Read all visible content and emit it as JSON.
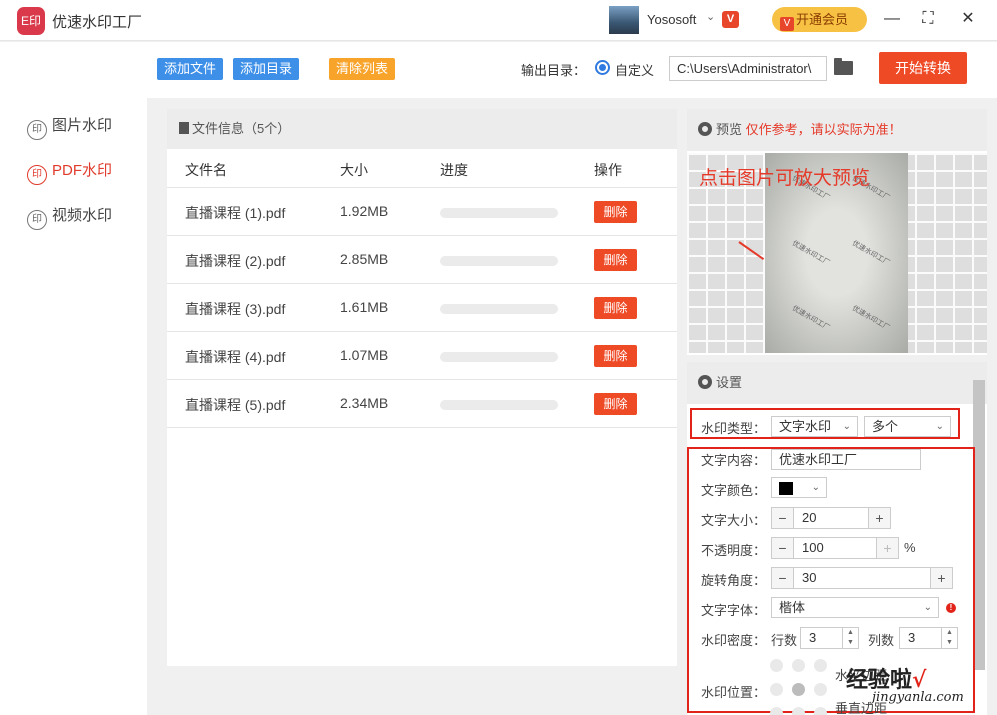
{
  "app": {
    "title": "优速水印工厂",
    "logo_text": "E印"
  },
  "user": {
    "name": "Yososoft",
    "vip_badge": "V",
    "vip_button": "开通会员"
  },
  "window": {
    "minimize": "—",
    "maximize": "⛶",
    "close": "✕"
  },
  "sidebar": {
    "items": [
      {
        "label": "图片水印",
        "icon": "印"
      },
      {
        "label": "PDF水印",
        "icon": "印"
      },
      {
        "label": "视频水印",
        "icon": "印"
      }
    ]
  },
  "toolbar": {
    "add_file": "添加文件",
    "add_folder": "添加目录",
    "clear_list": "清除列表",
    "output_label": "输出目录：",
    "custom_label": "自定义",
    "output_path": "C:\\Users\\Administrator\\",
    "start": "开始转换"
  },
  "files": {
    "header": "文件信息（5个）",
    "columns": {
      "name": "文件名",
      "size": "大小",
      "progress": "进度",
      "action": "操作"
    },
    "rows": [
      {
        "name": "直播课程 (1).pdf",
        "size": "1.92MB",
        "progress": 0,
        "action": "删除"
      },
      {
        "name": "直播课程 (2).pdf",
        "size": "2.85MB",
        "progress": 0,
        "action": "删除"
      },
      {
        "name": "直播课程 (3).pdf",
        "size": "1.61MB",
        "progress": 0,
        "action": "删除"
      },
      {
        "name": "直播课程 (4).pdf",
        "size": "1.07MB",
        "progress": 0,
        "action": "删除"
      },
      {
        "name": "直播课程 (5).pdf",
        "size": "2.34MB",
        "progress": 0,
        "action": "删除"
      }
    ]
  },
  "preview": {
    "title": "预览",
    "note": "仅作参考，请以实际为准！",
    "hint": "点击图片可放大预览",
    "doc_watermark": "优速水印工厂"
  },
  "settings": {
    "title": "设置",
    "watermark_type_label": "水印类型：",
    "watermark_type": "文字水印",
    "watermark_mode": "多个",
    "text_content_label": "文字内容：",
    "text_content": "优速水印工厂",
    "text_color_label": "文字颜色：",
    "text_color": "#000000",
    "text_size_label": "文字大小：",
    "text_size": "20",
    "opacity_label": "不透明度：",
    "opacity": "100",
    "opacity_unit": "%",
    "rotation_label": "旋转角度：",
    "rotation": "30",
    "font_label": "文字字体：",
    "font": "楷体",
    "density_label": "水印密度：",
    "rows_label": "行数",
    "rows": "3",
    "cols_label": "列数",
    "cols": "3",
    "position_label": "水印位置：",
    "h_margin_label": "水平边距",
    "v_margin_label": "垂直边距"
  },
  "brand_watermark": {
    "text": "经验啦",
    "check": "√",
    "url": "jingyanla.com"
  },
  "colors": {
    "accent_red": "#ee4a26",
    "blue": "#3d8fe8",
    "orange": "#f8a32a",
    "gold": "#f7c244"
  }
}
